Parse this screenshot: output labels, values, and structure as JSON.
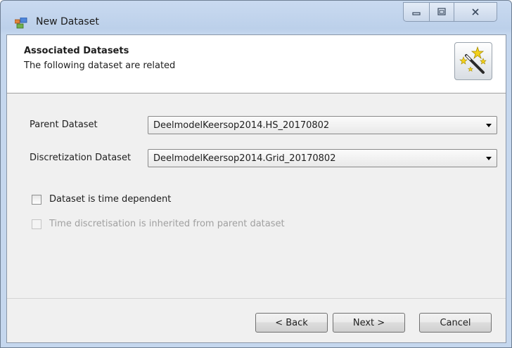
{
  "window": {
    "title": "New Dataset",
    "controls": {
      "minimize": "—",
      "maximize": "□",
      "close": "✕"
    }
  },
  "header": {
    "title": "Associated Datasets",
    "subtitle": "The following dataset are related"
  },
  "form": {
    "parent_label": "Parent Dataset",
    "parent_value": "DeelmodelKeersop2014.HS_20170802",
    "discretization_label": "Discretization Dataset",
    "discretization_value": "DeelmodelKeersop2014.Grid_20170802",
    "time_dependent_label": "Dataset is time dependent",
    "time_dependent_checked": false,
    "inherit_label": "Time discretisation is inherited from parent dataset",
    "inherit_checked": false,
    "inherit_enabled": false
  },
  "buttons": {
    "back": "< Back",
    "next": "Next >",
    "cancel": "Cancel"
  }
}
